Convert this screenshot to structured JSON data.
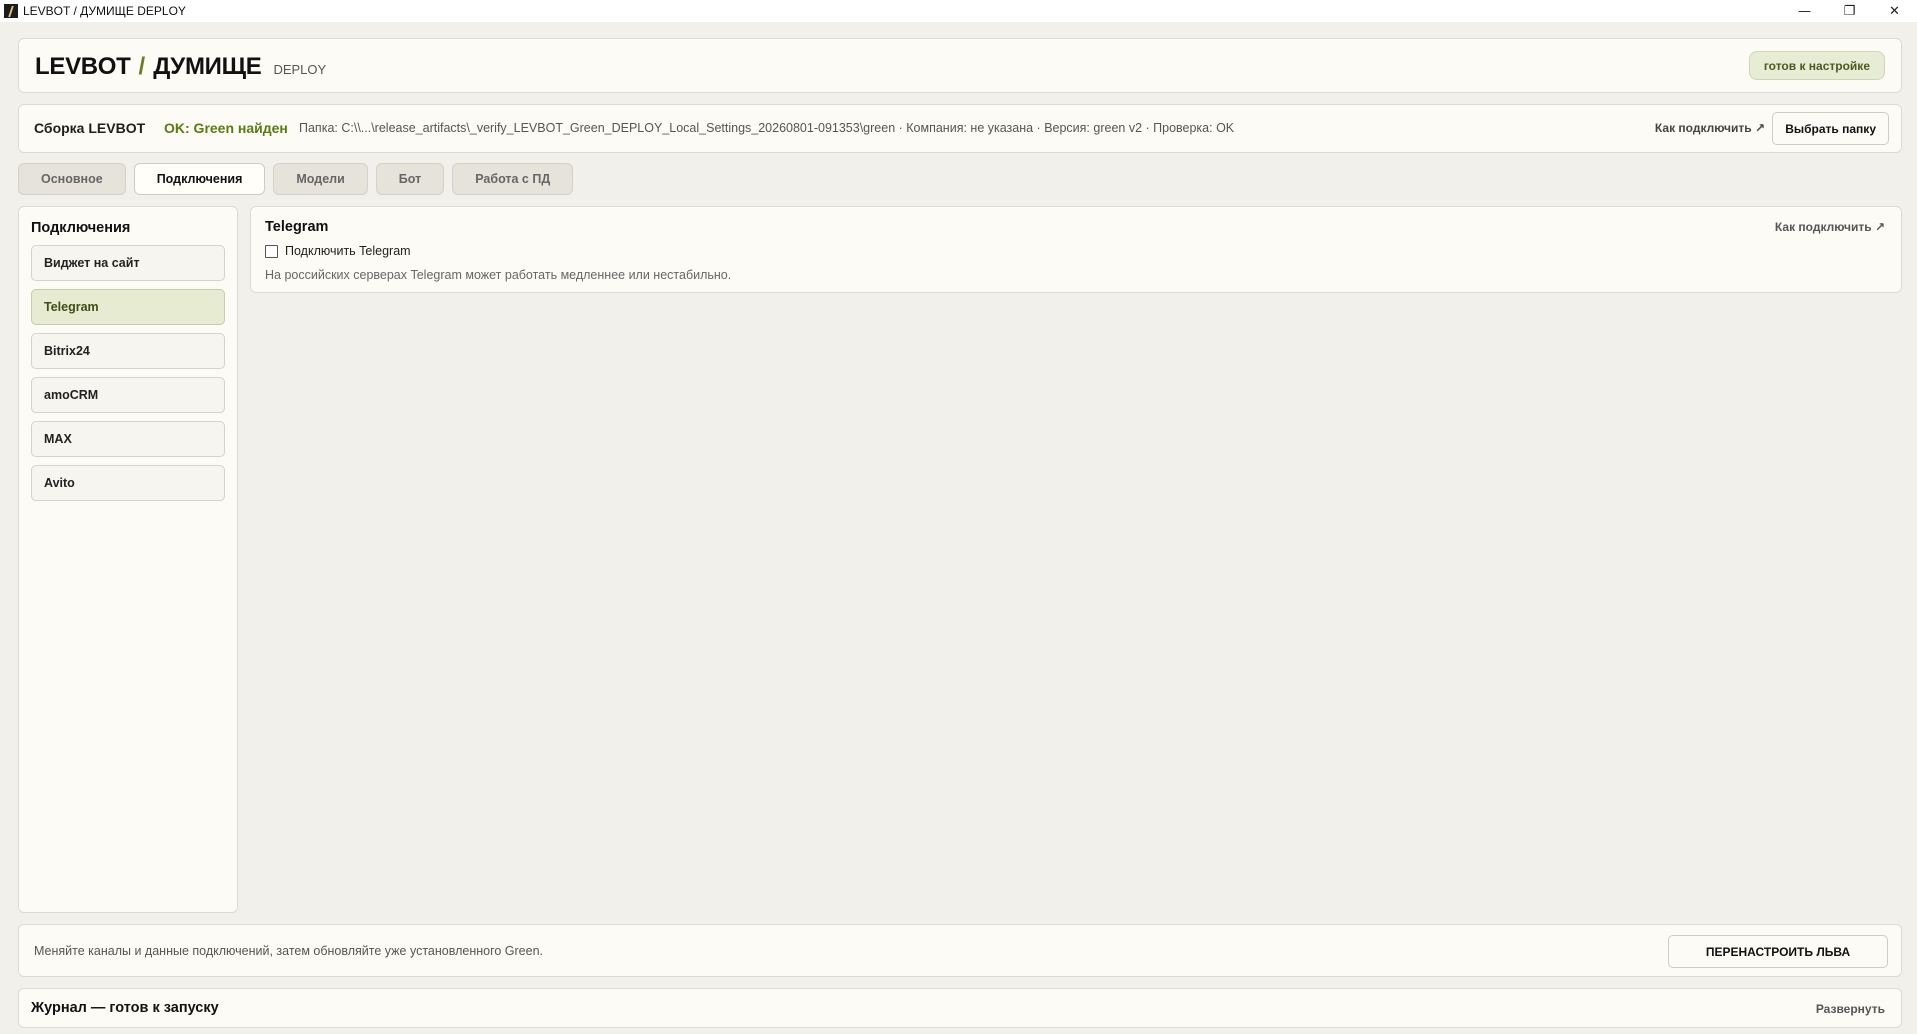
{
  "window": {
    "title": "LEVBOT / ДУМИЩЕ DEPLOY",
    "controls": {
      "minimize": "—",
      "restore": "❐",
      "close": "✕"
    }
  },
  "header": {
    "brand_primary": "LEVBOT",
    "brand_slash": "/",
    "brand_secondary": "ДУМИЩЕ",
    "brand_suffix": "DEPLOY",
    "status": "готов к настройке"
  },
  "build": {
    "label": "Сборка LEVBOT",
    "status": "OK: Green найден",
    "info": "Папка: C:\\\\...\\release_artifacts\\_verify_LEVBOT_Green_DEPLOY_Local_Settings_20260801-091353\\green  ·  Компания: не указана  ·  Версия: green v2  ·  Проверка: OK",
    "howto_link": "Как подключить ↗",
    "choose_folder": "Выбрать папку"
  },
  "tabs": [
    {
      "label": "Основное"
    },
    {
      "label": "Подключения",
      "active": true
    },
    {
      "label": "Модели"
    },
    {
      "label": "Бот"
    },
    {
      "label": "Работа с ПД"
    }
  ],
  "sidebar": {
    "title": "Подключения",
    "items": [
      {
        "label": "Виджет на сайт"
      },
      {
        "label": "Telegram",
        "active": true
      },
      {
        "label": "Bitrix24"
      },
      {
        "label": "amoCRM"
      },
      {
        "label": "MAX"
      },
      {
        "label": "Avito"
      }
    ]
  },
  "telegram": {
    "title": "Telegram",
    "howto_link": "Как подключить ↗",
    "checkbox_label": "Подключить Telegram",
    "checked": false,
    "note": "На российских серверах Telegram может работать медленнее или нестабильно."
  },
  "actions": {
    "message": "Меняйте каналы и данные подключений, затем обновляйте уже установленного Green.",
    "reconfigure_button": "ПЕРЕНАСТРОИТЬ ЛЬВА"
  },
  "journal": {
    "title": "Журнал — готов к запуску",
    "expand": "Развернуть"
  },
  "colors": {
    "accent_green": "#5a7a14",
    "active_bg": "#e6ebd1",
    "background": "#f1f0ea"
  }
}
